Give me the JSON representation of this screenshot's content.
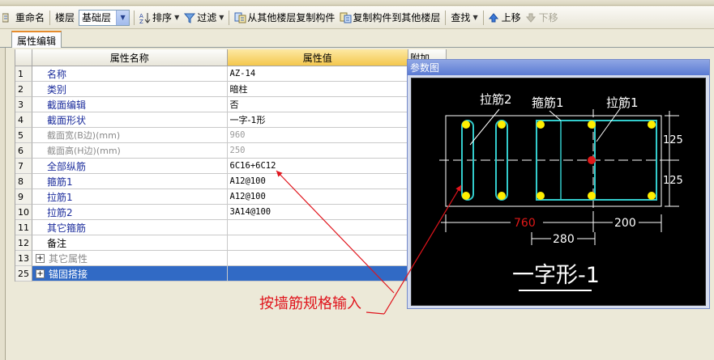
{
  "toolbar": {
    "rename_label": "重命名",
    "floor_label": "楼层",
    "floor_value": "基础层",
    "sort_label": "排序",
    "filter_label": "过滤",
    "copy_from_label": "从其他楼层复制构件",
    "copy_to_label": "复制构件到其他楼层",
    "find_label": "查找",
    "move_up_label": "上移",
    "move_down_label": "下移"
  },
  "tab": {
    "label": "属性编辑"
  },
  "grid": {
    "header_name": "属性名称",
    "header_value": "属性值",
    "header_extra": "附加",
    "rows": [
      {
        "num": "1",
        "name": "名称",
        "value": "AZ-14"
      },
      {
        "num": "2",
        "name": "类别",
        "value": "暗柱"
      },
      {
        "num": "3",
        "name": "截面编辑",
        "value": "否"
      },
      {
        "num": "4",
        "name": "截面形状",
        "value": "一字-1形"
      },
      {
        "num": "5",
        "name": "截面宽(B边)(mm)",
        "value": "960"
      },
      {
        "num": "6",
        "name": "截面高(H边)(mm)",
        "value": "250"
      },
      {
        "num": "7",
        "name": "全部纵筋",
        "value": "6C16+6C12"
      },
      {
        "num": "8",
        "name": "箍筋1",
        "value": "A12@100"
      },
      {
        "num": "9",
        "name": "拉筋1",
        "value": "A12@100"
      },
      {
        "num": "10",
        "name": "拉筋2",
        "value": "3A14@100"
      },
      {
        "num": "11",
        "name": "其它箍筋",
        "value": ""
      },
      {
        "num": "12",
        "name": "备注",
        "value": ""
      },
      {
        "num": "13",
        "name": "其它属性",
        "value": ""
      },
      {
        "num": "25",
        "name": "锚固搭接",
        "value": ""
      }
    ]
  },
  "panel": {
    "title": "参数图",
    "labels": {
      "tie2": "拉筋2",
      "stirrup1": "箍筋1",
      "tie1": "拉筋1",
      "dim_125_top": "125",
      "dim_125_bottom": "125",
      "dim_760": "760",
      "dim_200": "200",
      "dim_280": "280",
      "shape_name": "一字形-1"
    },
    "colors": {
      "rebar": "#33cccc",
      "bar_dot": "#ffee00",
      "center_dot": "#e01818",
      "dim_red": "#e01818",
      "lines": "#ffffff"
    }
  },
  "annotation": {
    "text": "按墙筋规格输入",
    "color": "#e0141c"
  }
}
